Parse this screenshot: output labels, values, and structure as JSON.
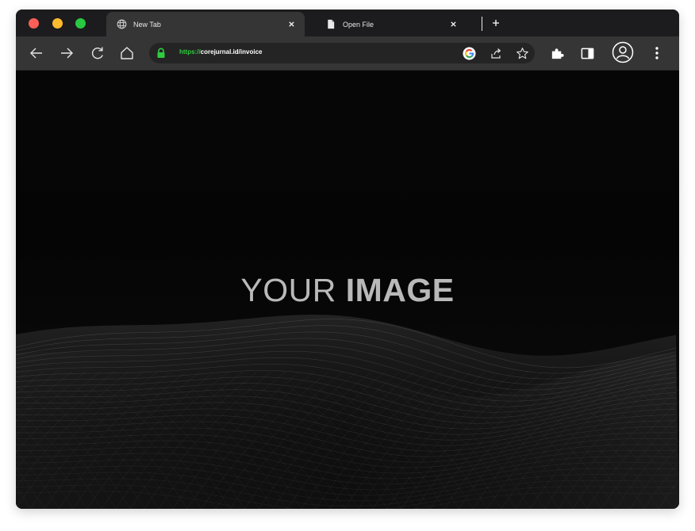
{
  "tabs": [
    {
      "title": "New Tab",
      "icon": "globe-icon",
      "active": true
    },
    {
      "title": "Open File",
      "icon": "file-icon",
      "active": false
    }
  ],
  "new_tab_label": "+",
  "close_label": "×",
  "address_bar": {
    "scheme": "https://",
    "host": "corejurnal.id/invoice",
    "secure": true
  },
  "content": {
    "placeholder_light": "YOUR",
    "placeholder_bold": "IMAGE"
  },
  "colors": {
    "close": "#ff5f57",
    "minimize": "#febc2e",
    "maximize": "#28c840",
    "url_scheme": "#2ecc40",
    "lock": "#2ecc40"
  }
}
